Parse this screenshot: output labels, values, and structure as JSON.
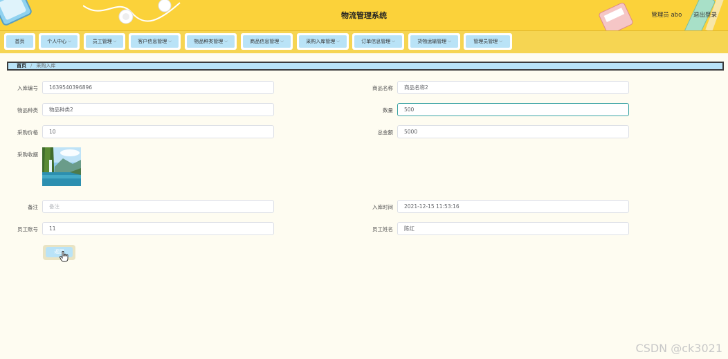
{
  "header": {
    "title": "物流管理系统",
    "user_label": "管理员 abo",
    "logout_label": "退出登录"
  },
  "nav": [
    {
      "label": "首页",
      "dropdown": false
    },
    {
      "label": "个人中心",
      "dropdown": true
    },
    {
      "label": "员工管理",
      "dropdown": true
    },
    {
      "label": "客户信息管理",
      "dropdown": true
    },
    {
      "label": "物品种类管理",
      "dropdown": true
    },
    {
      "label": "商品信息管理",
      "dropdown": true
    },
    {
      "label": "采购入库管理",
      "dropdown": true
    },
    {
      "label": "订单信息管理",
      "dropdown": true
    },
    {
      "label": "货物运输管理",
      "dropdown": true
    },
    {
      "label": "管理员管理",
      "dropdown": true
    }
  ],
  "breadcrumb": {
    "home": "首页",
    "separator": "/",
    "current": "采购入库"
  },
  "form": {
    "stock_no": {
      "label": "入库编号",
      "value": "1639540396896"
    },
    "product_name": {
      "label": "商品名称",
      "value": "商品名称2"
    },
    "category": {
      "label": "物品种类",
      "value": "物品种类2"
    },
    "quantity": {
      "label": "数量",
      "value": "500"
    },
    "price": {
      "label": "采购价格",
      "value": "10"
    },
    "total": {
      "label": "总金额",
      "value": "5000"
    },
    "receipt": {
      "label": "采购收据"
    },
    "remark": {
      "label": "备注",
      "placeholder": "备注"
    },
    "stock_time": {
      "label": "入库时间",
      "value": "2021-12-15 11:53:16"
    },
    "employee_no": {
      "label": "员工账号",
      "value": "11"
    },
    "employee_name": {
      "label": "员工姓名",
      "value": "陈红"
    }
  },
  "submit": {
    "label": "返回"
  },
  "watermark": "CSDN @ck3021",
  "colors": {
    "header_bg": "#fbd23a",
    "nav_pill": "#b9e3f7",
    "page_bg": "#fefcf1",
    "focus_border": "#38a2a2"
  }
}
